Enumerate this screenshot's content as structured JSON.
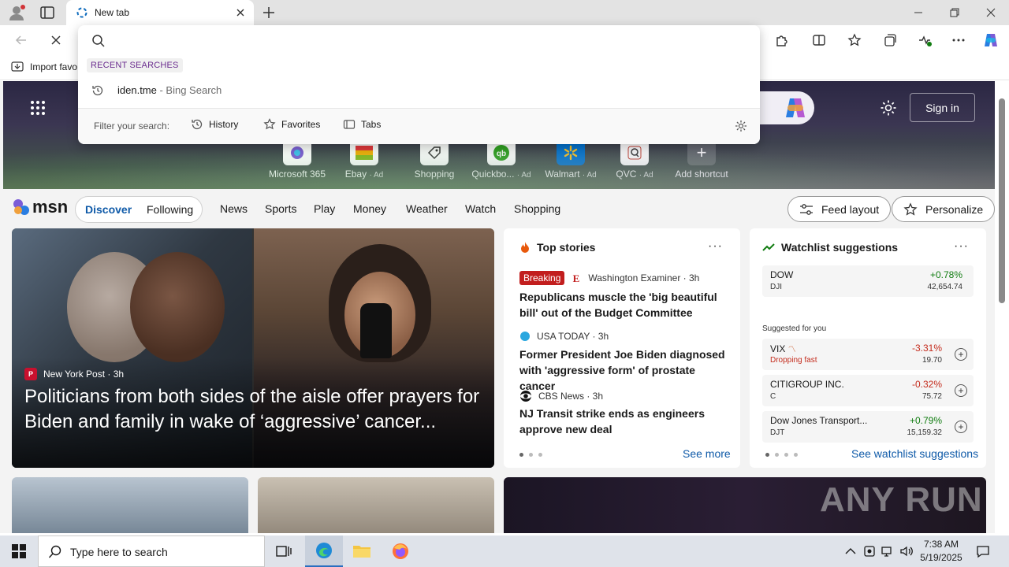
{
  "browser": {
    "tab_title": "New tab",
    "favorites_import_label": "Import favo"
  },
  "omnibox": {
    "section_label": "RECENT SEARCHES",
    "recent": {
      "query": "iden.tme",
      "suffix": " - Bing Search"
    },
    "filter_label": "Filter your search:",
    "filters": [
      "History",
      "Favorites",
      "Tabs"
    ]
  },
  "hero": {
    "signin_label": "Sign in",
    "shortcuts": [
      {
        "label": "Microsoft 365",
        "ad": ""
      },
      {
        "label": "Ebay",
        "ad": "· Ad"
      },
      {
        "label": "Shopping",
        "ad": ""
      },
      {
        "label": "Quickbo...",
        "ad": "· Ad"
      },
      {
        "label": "Walmart",
        "ad": "· Ad"
      },
      {
        "label": "QVC",
        "ad": "· Ad"
      },
      {
        "label": "Add shortcut",
        "ad": ""
      }
    ]
  },
  "msn_nav": {
    "logo_text": "msn",
    "segments": [
      "Discover",
      "Following"
    ],
    "items": [
      "News",
      "Sports",
      "Play",
      "Money",
      "Weather",
      "Watch",
      "Shopping"
    ],
    "feed_layout_label": "Feed layout",
    "personalize_label": "Personalize"
  },
  "main_story": {
    "source": "New York Post · 3h",
    "source_abbr": "P",
    "title": "Politicians from both sides of the aisle offer prayers for Biden and family in wake of ‘aggressive’ cancer..."
  },
  "top_stories": {
    "header": "Top stories",
    "more": "···",
    "stories": [
      {
        "badge": "Breaking",
        "source": "Washington Examiner · 3h",
        "title": "Republicans muscle the 'big beautiful bill' out of the Budget Committee"
      },
      {
        "badge": "",
        "source": "USA TODAY · 3h",
        "title": "Former President Joe Biden diagnosed with 'aggressive form' of prostate cancer"
      },
      {
        "badge": "",
        "source": "CBS News · 3h",
        "title": "NJ Transit strike ends as engineers approve new deal"
      }
    ],
    "see_more": "See more"
  },
  "watchlist": {
    "header": "Watchlist suggestions",
    "more": "···",
    "top": {
      "name": "DOW",
      "symbol": "DJI",
      "change": "+0.78%",
      "price": "42,654.74"
    },
    "suggested_label": "Suggested for you",
    "rows": [
      {
        "name": "VIX",
        "symbol": "Dropping fast",
        "change": "-3.31%",
        "price": "19.70"
      },
      {
        "name": "CITIGROUP INC.",
        "symbol": "C",
        "change": "-0.32%",
        "price": "75.72"
      },
      {
        "name": "Dow Jones Transport...",
        "symbol": "DJT",
        "change": "+0.79%",
        "price": "15,159.32"
      }
    ],
    "see_link": "See watchlist suggestions"
  },
  "taskbar": {
    "search_placeholder": "Type here to search",
    "time": "7:38 AM",
    "date": "5/19/2025"
  },
  "watermark": "ANY RUN",
  "colors": {
    "accent": "#0f5aa8",
    "positive": "#107c10",
    "negative": "#c42b1c",
    "breaking": "#c21e1e"
  }
}
